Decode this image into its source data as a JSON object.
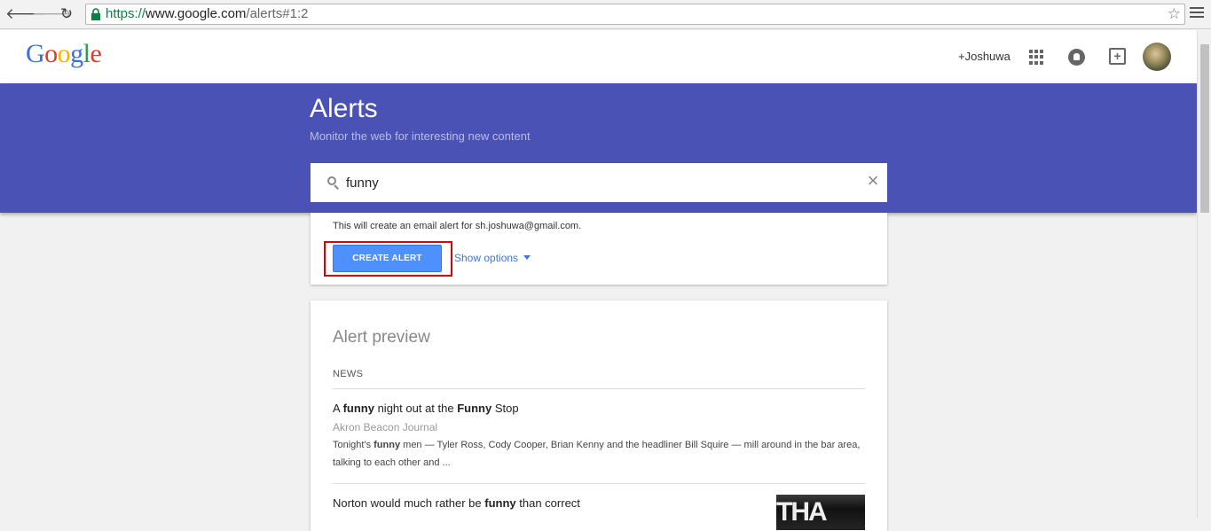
{
  "browser": {
    "url_scheme": "https://",
    "url_host": "www.google.com",
    "url_path": "/alerts#1:2",
    "back_glyph": "🡐",
    "forward_glyph": "🡒",
    "reload_glyph": "↻",
    "star_glyph": "☆"
  },
  "header": {
    "logo": [
      "G",
      "o",
      "o",
      "g",
      "l",
      "e"
    ],
    "logo_colors": [
      "#3b6fe0",
      "#e2392a",
      "#f5b400",
      "#3b6fe0",
      "#2ba14b",
      "#e2392a"
    ],
    "user_name": "+Joshuwa",
    "share_glyph": "+"
  },
  "banner": {
    "title": "Alerts",
    "subtitle": "Monitor the web for interesting new content",
    "background": "#4a52b5"
  },
  "search": {
    "value": "funny",
    "clear_glyph": "×"
  },
  "create": {
    "note": "This will create an email alert for sh.joshuwa@gmail.com.",
    "button_label": "CREATE ALERT",
    "show_options_label": "Show options",
    "button_color": "#4d90fe",
    "highlight_color": "#e00000"
  },
  "preview": {
    "title": "Alert preview",
    "section_label": "NEWS",
    "articles": [
      {
        "title_parts": [
          {
            "text": "A ",
            "bold": false
          },
          {
            "text": "funny",
            "bold": true
          },
          {
            "text": " night out at the ",
            "bold": false
          },
          {
            "text": "Funny",
            "bold": true
          },
          {
            "text": " Stop",
            "bold": false
          }
        ],
        "source": "Akron Beacon Journal",
        "snippet_parts": [
          {
            "text": "Tonight's ",
            "bold": false
          },
          {
            "text": "funny",
            "bold": true
          },
          {
            "text": " men — Tyler Ross, Cody Cooper, Brian Kenny and the headliner Bill Squire — mill around in the bar area, talking to each other and ...",
            "bold": false
          }
        ]
      },
      {
        "title_parts": [
          {
            "text": "Norton would much rather be ",
            "bold": false
          },
          {
            "text": "funny",
            "bold": true
          },
          {
            "text": " than correct",
            "bold": false
          }
        ],
        "thumbnail_text": "THA"
      }
    ]
  }
}
